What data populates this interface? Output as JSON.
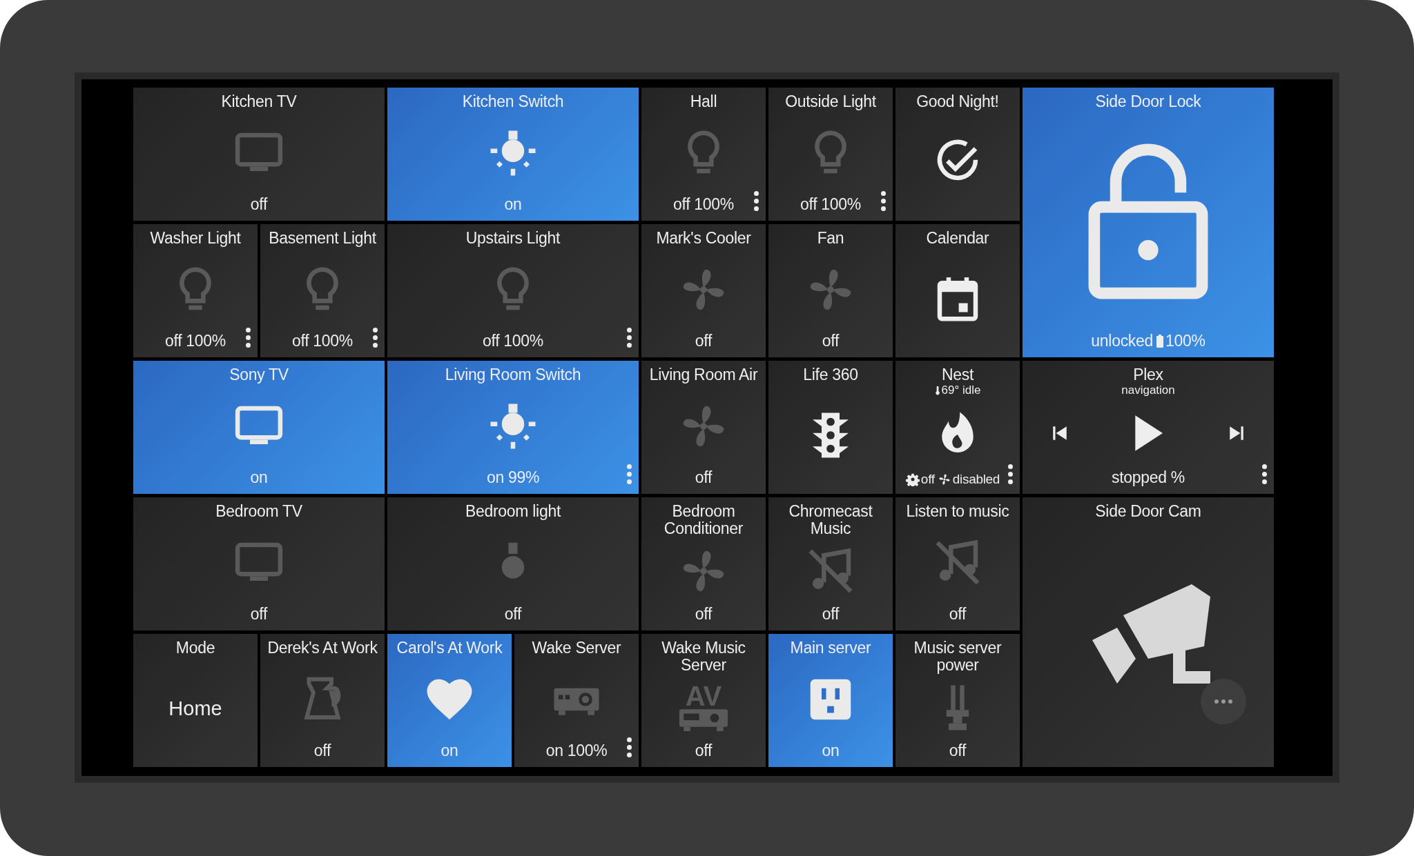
{
  "rows": [
    [
      {
        "title": "Kitchen TV",
        "kind": "tv",
        "on": false,
        "status": "off",
        "menu": false
      },
      {
        "title": "Kitchen Switch",
        "kind": "bulb-rays",
        "on": true,
        "status": "on",
        "menu": false
      },
      {
        "title": "Hall",
        "kind": "bulb-outline",
        "on": false,
        "status": "off 100%",
        "menu": true
      },
      {
        "title": "Outside Light",
        "kind": "bulb-outline",
        "on": false,
        "status": "off 100%",
        "menu": true
      },
      {
        "title": "Good Night!",
        "kind": "check-circle",
        "menu": false
      },
      {
        "title": "Side Door Lock",
        "kind": "lock-open",
        "on": true,
        "status_parts": [
          {
            "kind": "none",
            "text": "unlocked"
          },
          {
            "kind": "battery",
            "text": "100%"
          }
        ],
        "menu": false
      }
    ],
    [
      {
        "title": "Washer Light",
        "kind": "bulb-outline",
        "on": false,
        "status": "off 100%",
        "menu": true
      },
      {
        "title": "Basement Light",
        "kind": "bulb-outline",
        "on": false,
        "status": "off 100%",
        "menu": true
      },
      {
        "title": "Upstairs Light",
        "kind": "bulb-outline",
        "on": false,
        "status": "off 100%",
        "menu": true
      },
      {
        "title": "Mark's Cooler",
        "kind": "fan",
        "on": false,
        "status": "off",
        "menu": false
      },
      {
        "title": "Fan",
        "kind": "fan",
        "on": false,
        "status": "off",
        "menu": false
      },
      {
        "title": "Calendar",
        "kind": "calendar",
        "menu": false
      }
    ],
    [
      {
        "title": "Sony TV",
        "kind": "tv",
        "on": true,
        "status": "on",
        "menu": false
      },
      {
        "title": "Living Room Switch",
        "kind": "bulb-rays",
        "on": true,
        "status": "on 99%",
        "menu": true
      },
      {
        "title": "Living Room Air",
        "kind": "fan",
        "on": false,
        "status": "off",
        "menu": false
      },
      {
        "title": "Life 360",
        "kind": "traffic-light",
        "menu": false
      },
      {
        "title": "Nest",
        "kind": "flame",
        "subtitle_parts": [
          {
            "kind": "thermometer",
            "text": "69° idle"
          }
        ],
        "status_parts": [
          {
            "kind": "gear",
            "text": "off"
          },
          {
            "kind": "fan",
            "text": "disabled"
          }
        ],
        "menu": true
      },
      {
        "title": "Plex",
        "kind": "media",
        "subtitle": "navigation",
        "status": "stopped %",
        "menu": true
      }
    ],
    [
      {
        "title": "Bedroom TV",
        "kind": "tv",
        "on": false,
        "status": "off",
        "menu": false
      },
      {
        "title": "Bedroom light",
        "kind": "bulb-solid",
        "on": false,
        "status": "off",
        "menu": false
      },
      {
        "title": "Bedroom Conditioner",
        "kind": "fan",
        "on": false,
        "status": "off",
        "menu": false
      },
      {
        "title": "Chromecast Music",
        "kind": "music-off",
        "on": false,
        "status": "off",
        "menu": false
      },
      {
        "title": "Listen to music",
        "kind": "music-off",
        "on": false,
        "status": "off",
        "menu": false
      },
      {
        "title": "Side Door Cam",
        "kind": "camera",
        "more": true
      }
    ],
    [
      {
        "title": "Mode",
        "kind": "mode",
        "value": "Home",
        "menu": false
      },
      {
        "title": "Derek's At Work",
        "kind": "kettle",
        "on": false,
        "status": "off",
        "menu": false
      },
      {
        "title": "Carol's At Work",
        "kind": "heart",
        "on": true,
        "status": "on",
        "menu": false
      },
      {
        "title": "Wake Server",
        "kind": "projector",
        "on": false,
        "status": "on 100%",
        "menu": true
      },
      {
        "title": "Wake Music Server",
        "kind": "receiver",
        "glyph": "AV",
        "on": false,
        "status": "off",
        "menu": false
      },
      {
        "title": "Main server",
        "kind": "outlet",
        "on": true,
        "status": "on",
        "menu": false
      },
      {
        "title": "Music server power",
        "kind": "pillar",
        "on": false,
        "status": "off",
        "menu": false
      }
    ]
  ]
}
